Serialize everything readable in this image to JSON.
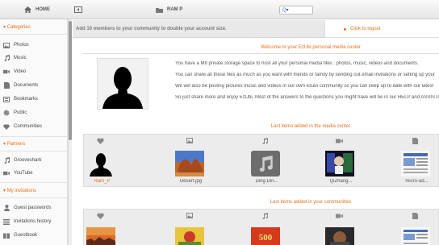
{
  "topbar": {
    "home_label": "HOME",
    "user_label": "RAM P",
    "search_value": "Q▾"
  },
  "sidebar": {
    "categories_header": "Categories",
    "categories": [
      {
        "label": "Photos",
        "icon": "photo-icon"
      },
      {
        "label": "Music",
        "icon": "music-note-icon"
      },
      {
        "label": "Video",
        "icon": "video-camera-icon"
      },
      {
        "label": "Documents",
        "icon": "document-icon"
      },
      {
        "label": "Bookmarks",
        "icon": "bookmark-icon"
      },
      {
        "label": "Public",
        "icon": "globe-icon"
      },
      {
        "label": "Communities",
        "icon": "heart-icon"
      }
    ],
    "partners_header": "Partners",
    "partners": [
      {
        "label": "Grooveshark",
        "icon": "music-note-icon"
      },
      {
        "label": "YouTube",
        "icon": "video-camera-icon"
      }
    ],
    "invitations_header": "My invitations",
    "invitations": [
      {
        "label": "Guest passwords",
        "icon": "user-icon"
      },
      {
        "label": "Invitations history",
        "icon": "list-icon"
      },
      {
        "label": "Guestbook",
        "icon": "book-icon"
      }
    ]
  },
  "notice": {
    "text": "Add 10 members to your community to double your account size.",
    "logout_label": "Click to logout"
  },
  "welcome": {
    "title": "Welcome to your EzUbi personal media center",
    "paragraphs": [
      "You have a Mb private storage space to host all your personal media files : photos, music, videos and documents.",
      "You can share all these files as much as you want with friends or family by sending out email invitations or setting up your",
      "We will also be posting pictures music and videos in our own ezubi community so you can keep up to date with our latest",
      "So just share more and enjoy EzUbi, Most of the answers to the questions you might have will be in our HELP and ASSISTANCE"
    ]
  },
  "media_center": {
    "title": "Last items added in the media center",
    "items": [
      {
        "label": "Ram_P",
        "category_icon": "heart-icon"
      },
      {
        "label": "Desert.jpg",
        "category_icon": "photo-icon"
      },
      {
        "label": "Ding Din...",
        "category_icon": "music-note-icon"
      },
      {
        "label": "QiZhang...",
        "category_icon": "video-camera-icon"
      },
      {
        "label": "micro-ad...",
        "category_icon": "document-icon"
      }
    ]
  },
  "communities": {
    "title": "Last items added in your communities",
    "items": [
      {
        "label": "",
        "category_icon": "heart-icon"
      },
      {
        "label": "",
        "category_icon": "photo-icon"
      },
      {
        "label": "500",
        "category_icon": "music-note-icon"
      },
      {
        "label": "",
        "category_icon": "video-camera-icon"
      },
      {
        "label": "",
        "category_icon": "document-icon"
      }
    ]
  }
}
